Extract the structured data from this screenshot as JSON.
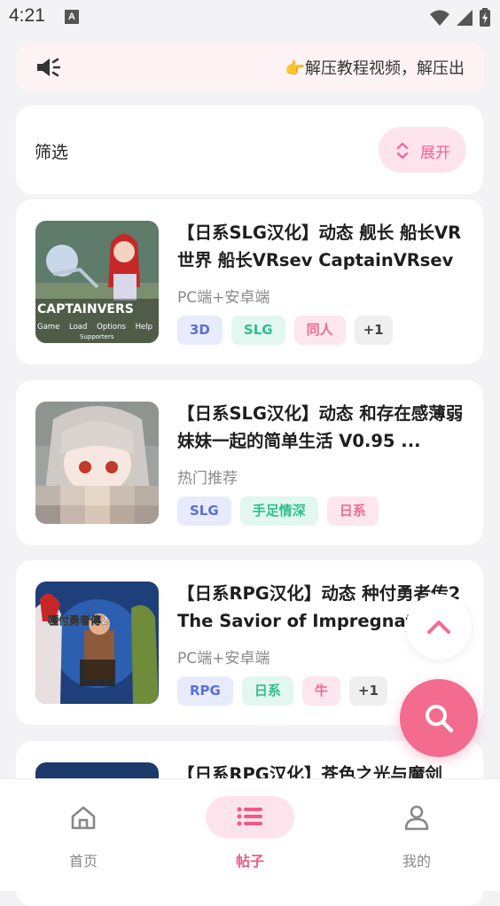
{
  "status_bar": {
    "time": "4:21",
    "badge": "A"
  },
  "notice": {
    "icon": "speaker-icon",
    "text": "👉解压教程视频，解压出"
  },
  "filter": {
    "title": "筛选",
    "expand_label": "展开",
    "expand_icon": "expand-vertical-icon"
  },
  "posts": [
    {
      "title": "【日系SLG汉化】动态 舰长 船长VR世界 船长VRsev CaptainVRsev",
      "subtitle": "PC端+安卓端",
      "tags": [
        "3D",
        "SLG",
        "同人",
        "+1"
      ],
      "thumb_text": "CAPTAINVERS",
      "thumb_menu": [
        "Game",
        "Load",
        "Options",
        "Help"
      ],
      "thumb_sub": "Supporters"
    },
    {
      "title": "【日系SLG汉化】动态 和存在感薄弱妹妹一起的简单生活 V0.95 ...",
      "subtitle": "热门推荐",
      "tags": [
        "SLG",
        "手足情深",
        "日系"
      ]
    },
    {
      "title": "【日系RPG汉化】动态 种付勇者传2 The Savior of Impregnation",
      "subtitle": "PC端+安卓端",
      "tags": [
        "RPG",
        "日系",
        "牛",
        "+1"
      ],
      "thumb_text": "種付勇者傳2"
    },
    {
      "title": "【日系RPG汉化】苍色之光与魔剑"
    }
  ],
  "fab": {
    "scroll_top_icon": "chevron-up-icon",
    "search_icon": "search-icon"
  },
  "nav": [
    {
      "label": "首页",
      "icon": "home-icon"
    },
    {
      "label": "帖子",
      "icon": "list-icon"
    },
    {
      "label": "我的",
      "icon": "user-icon"
    }
  ],
  "colors": {
    "accent": "#f36b8f",
    "background": "#f3f3f6"
  }
}
